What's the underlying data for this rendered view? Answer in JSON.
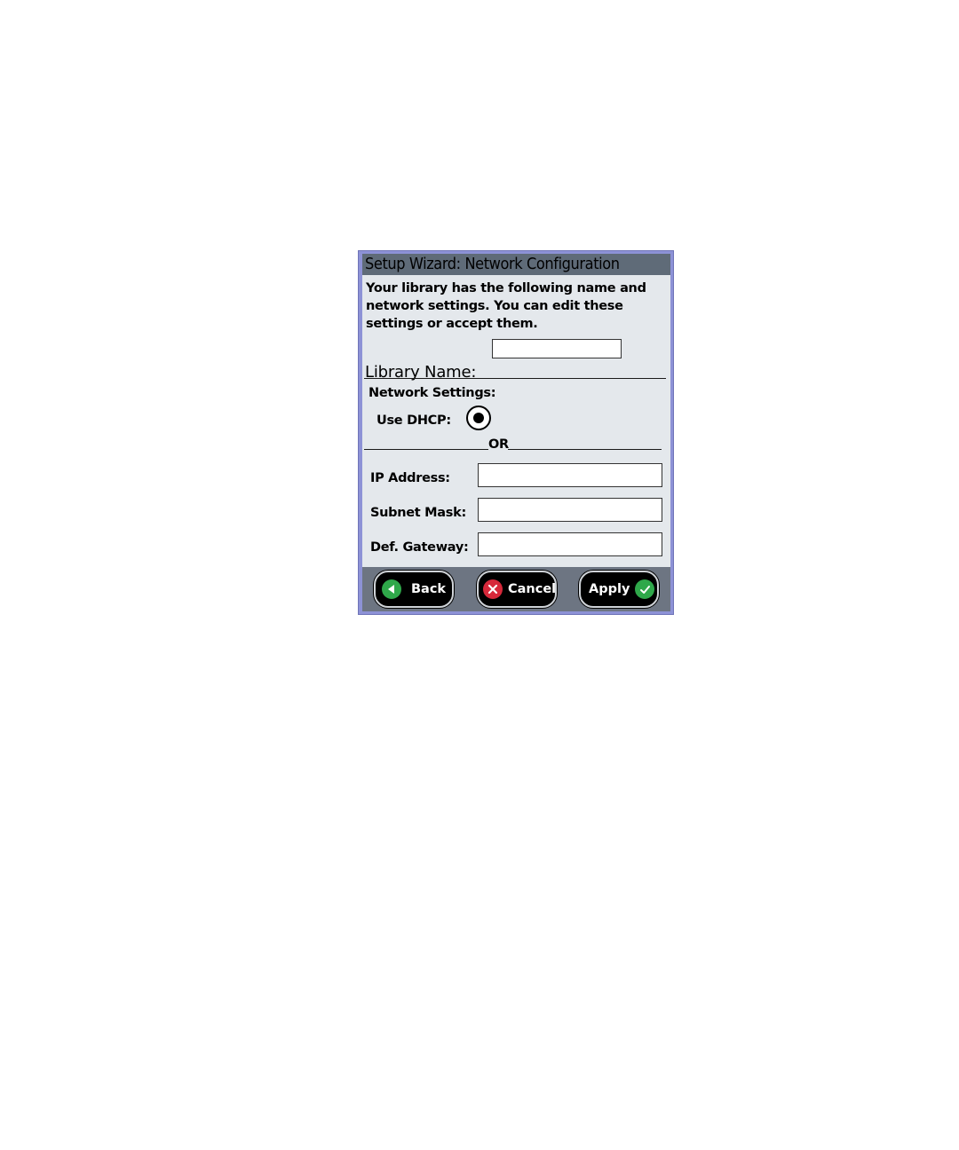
{
  "window": {
    "title": "Setup Wizard: Network Configuration"
  },
  "intro": {
    "text": "Your library has the following name and network settings. You can edit these settings or accept them."
  },
  "library": {
    "label": "Library Name:",
    "value": ""
  },
  "network": {
    "heading": "Network Settings:",
    "dhcp_label": "Use DHCP:",
    "dhcp_selected": true,
    "or_label": "OR",
    "ip_label": "IP Address:",
    "ip_value": "",
    "subnet_label": "Subnet Mask:",
    "subnet_value": "",
    "gateway_label": "Def. Gateway:",
    "gateway_value": ""
  },
  "footer": {
    "back_label": "Back",
    "cancel_label": "Cancel",
    "apply_label": "Apply"
  },
  "icons": {
    "back": "back-arrow-icon",
    "cancel": "cancel-x-icon",
    "apply": "checkmark-icon"
  },
  "colors": {
    "frame": "#8d92d6",
    "titlebar": "#5f6b78",
    "panel": "#e4e8ec",
    "footer": "#6d7582",
    "back_icon": "#2fa84a",
    "cancel_icon": "#d6283a",
    "apply_icon": "#2fa84a"
  }
}
